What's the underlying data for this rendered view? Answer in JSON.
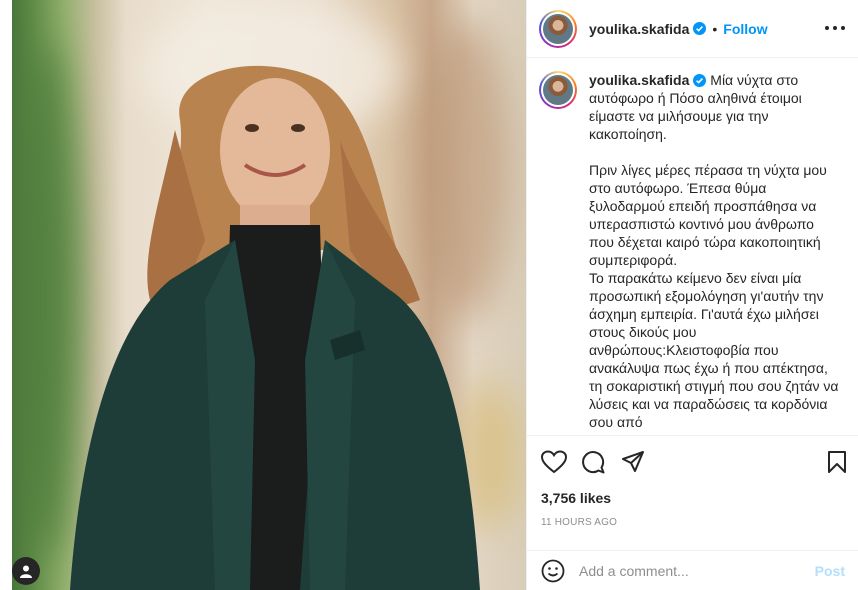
{
  "post": {
    "username": "youlika.skafida",
    "follow_label": "Follow",
    "dot": "•",
    "caption_username": "youlika.skafida",
    "caption_text": " Μία νύχτα στο αυτόφωρο ή Πόσο αληθινά έτοιμοι είμαστε να μιλήσουμε για την κακοποίηση.\n\nΠριν λίγες μέρες πέρασα τη νύχτα μου στο αυτόφωρο. Έπεσα θύμα ξυλοδαρμού επειδή προσπάθησα να υπερασπιστώ κοντινό μου άνθρωπο που δέχεται καιρό τώρα κακοποιητική συμπεριφορά.\nΤο παρακάτω κείμενο δεν είναι μία προσωπική εξομολόγηση γι'αυτήν την άσχημη εμπειρία. Γι'αυτά έχω μιλήσει στους δικούς μου ανθρώπους:Κλειστοφοβία που ανακάλυψα πως έχω ή που απέκτησα, τη σοκαριστική στιγμή που σου ζητάν να λύσεις και να παραδώσεις τα κορδόνια σου από",
    "likes": "3,756 likes",
    "timestamp": "11 HOURS AGO",
    "comment_placeholder": "Add a comment...",
    "post_label": "Post"
  },
  "icons": {
    "like": "heart-icon",
    "comment": "comment-icon",
    "share": "send-icon",
    "save": "bookmark-icon",
    "emoji": "smiley-icon",
    "more": "more-dots-icon",
    "verified": "verified-badge-icon",
    "tag": "user-tag-icon"
  },
  "colors": {
    "accent": "#0095f6",
    "post_disabled": "#b2dffc",
    "muted": "#8e8e8e"
  }
}
